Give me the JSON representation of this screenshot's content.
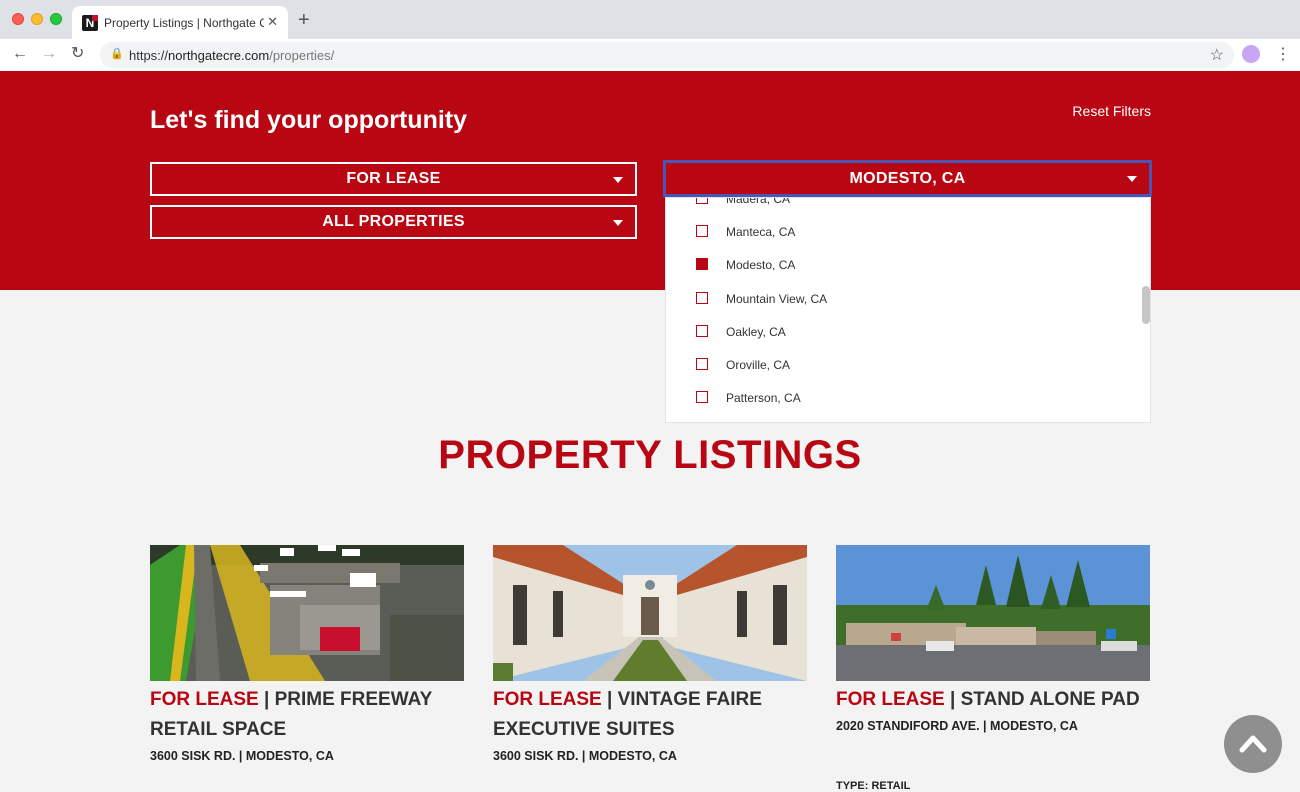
{
  "browser": {
    "tab_title": "Property Listings | Northgate C",
    "favicon_letter": "N",
    "url_prefix": "https://",
    "url_host": "northgatecre.com",
    "url_path": "/properties/"
  },
  "hero": {
    "title": "Let's find your opportunity",
    "reset_label": "Reset Filters",
    "filter_type": "FOR LEASE",
    "filter_property": "ALL PROPERTIES",
    "filter_city": "MODESTO, CA"
  },
  "city_dropdown": {
    "partial_top_option": "Madera, CA",
    "options": [
      {
        "label": "Manteca, CA",
        "checked": false
      },
      {
        "label": "Modesto, CA",
        "checked": true
      },
      {
        "label": "Mountain View, CA",
        "checked": false
      },
      {
        "label": "Oakley, CA",
        "checked": false
      },
      {
        "label": "Oroville, CA",
        "checked": false
      },
      {
        "label": "Patterson, CA",
        "checked": false
      }
    ]
  },
  "listings": {
    "title": "PROPERTY LISTINGS",
    "cards": [
      {
        "status": "FOR LEASE",
        "name": "PRIME FREEWAY RETAIL SPACE",
        "address": "3600 SISK RD. | MODESTO, CA"
      },
      {
        "status": "FOR LEASE",
        "name": "VINTAGE FAIRE EXECUTIVE SUITES",
        "address": "3600 SISK RD. | MODESTO, CA"
      },
      {
        "status": "FOR LEASE",
        "name": "STAND ALONE PAD",
        "address": "2020 STANDIFORD AVE. | MODESTO, CA",
        "type": "TYPE: RETAIL"
      }
    ]
  },
  "colors": {
    "brand_red": "#b80612",
    "focus_outline": "#4b55b8"
  }
}
